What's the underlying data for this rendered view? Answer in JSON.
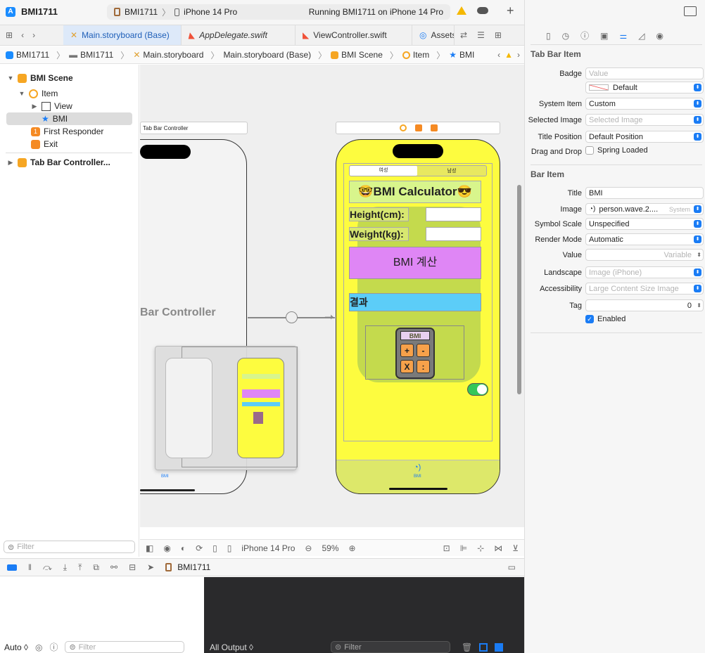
{
  "titlebar": {
    "project": "BMI1711",
    "scheme": "BMI1711",
    "device": "iPhone 14 Pro",
    "status": "Running BMI1711 on iPhone 14 Pro",
    "add": "+"
  },
  "tabs": [
    {
      "label": "Main.storyboard (Base)",
      "icon": "storyboard-icon",
      "active": true
    },
    {
      "label": "AppDelegate.swift",
      "icon": "swift-icon",
      "active": false
    },
    {
      "label": "ViewController.swift",
      "icon": "swift-icon",
      "active": false
    },
    {
      "label": "Assets",
      "icon": "assets-icon",
      "active": false
    }
  ],
  "breadcrumb": [
    "BMI1711",
    "BMI1711",
    "Main.storyboard",
    "Main.storyboard (Base)",
    "BMI Scene",
    "Item",
    "BMI"
  ],
  "navigator": {
    "items": [
      {
        "label": "BMI Scene"
      },
      {
        "label": "Item"
      },
      {
        "label": "View"
      },
      {
        "label": "BMI"
      },
      {
        "label": "First Responder"
      },
      {
        "label": "Exit"
      },
      {
        "label": "Tab Bar Controller..."
      }
    ],
    "filter_placeholder": "Filter"
  },
  "canvas": {
    "tbc_header": "Tab Bar Controller",
    "tbc_title": "Bar Controller",
    "tbc_tab": "BMI",
    "segment_left": "여성",
    "segment_right": "남성",
    "app_title": "🤓BMI Calculator😎",
    "height_label": "Height(cm):",
    "weight_label": "Weight(kg):",
    "calc_button": "BMI 계산",
    "result_label": "결과",
    "calc_image_text": "BMI",
    "calc_keys": [
      "+",
      "-",
      "X",
      ":"
    ],
    "tab_item": "BMI"
  },
  "canvas_bar": {
    "device": "iPhone 14 Pro",
    "zoom": "59%"
  },
  "debug": {
    "target": "BMI1711",
    "auto": "Auto ◊",
    "filter": "Filter",
    "output": "All Output ◊",
    "filter2": "Filter"
  },
  "inspector": {
    "tabbar_section": "Tab Bar Item",
    "badge_label": "Badge",
    "badge_placeholder": "Value",
    "badge_color": "Default",
    "system_item_label": "System Item",
    "system_item": "Custom",
    "selected_image_label": "Selected Image",
    "selected_image_placeholder": "Selected Image",
    "title_position_label": "Title Position",
    "title_position": "Default Position",
    "drag_drop_label": "Drag and Drop",
    "drag_drop_value": "Spring Loaded",
    "baritem_section": "Bar Item",
    "title_label": "Title",
    "title_value": "BMI",
    "image_label": "Image",
    "image_value": "person.wave.2....",
    "image_system": "System",
    "symbol_scale_label": "Symbol Scale",
    "symbol_scale": "Unspecified",
    "render_mode_label": "Render Mode",
    "render_mode": "Automatic",
    "value_label": "Value",
    "value_placeholder": "Variable",
    "landscape_label": "Landscape",
    "landscape_placeholder": "Image (iPhone)",
    "accessibility_label": "Accessibility",
    "accessibility_placeholder": "Large Content Size Image",
    "tag_label": "Tag",
    "tag_value": "0",
    "enabled_label": "Enabled"
  },
  "colors": {
    "accent": "#1a7cf5",
    "phone_yellow": "#fdfc3f",
    "title_green": "#d8f58c",
    "button_purple": "#df86f5",
    "result_blue": "#5ccdf8"
  }
}
